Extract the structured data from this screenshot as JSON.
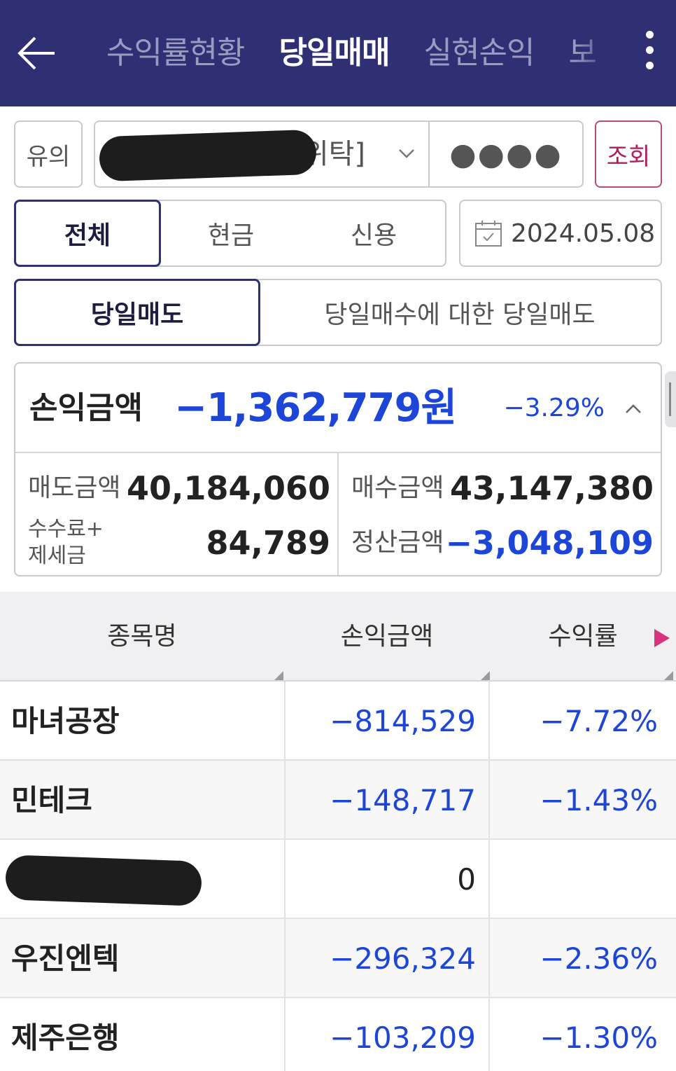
{
  "header": {
    "tabs": [
      {
        "label": "수익률현황",
        "active": false
      },
      {
        "label": "당일매매",
        "active": true
      },
      {
        "label": "실현손익",
        "active": false
      },
      {
        "label": "보",
        "active": false
      }
    ],
    "icons": {
      "back": "arrow-left-icon",
      "menu": "kebab-menu-icon"
    }
  },
  "account": {
    "notice_label": "유의",
    "account_suffix": "위탁]",
    "password_mask": "●●●●",
    "query_label": "조회"
  },
  "filters": {
    "type_tabs": [
      {
        "label": "전체",
        "active": true
      },
      {
        "label": "현금",
        "active": false
      },
      {
        "label": "신용",
        "active": false
      }
    ],
    "date": "2024.05.08",
    "mode_tabs": [
      {
        "label": "당일매도",
        "active": true
      },
      {
        "label": "당일매수에 대한 당일매도",
        "active": false
      }
    ]
  },
  "summary": {
    "pl_label": "손익금액",
    "pl_amount": "−1,362,779원",
    "pl_rate": "−3.29%",
    "sell_label": "매도금액",
    "sell_amount": "40,184,060",
    "fee_label_1": "수수료+",
    "fee_label_2": "제세금",
    "fee_amount": "84,789",
    "buy_label": "매수금액",
    "buy_amount": "43,147,380",
    "settle_label": "정산금액",
    "settle_amount": "−3,048,109"
  },
  "table": {
    "headers": [
      "종목명",
      "손익금액",
      "수익률"
    ],
    "rows": [
      {
        "name": "마녀공장",
        "pl": "−814,529",
        "rate": "−7.72%"
      },
      {
        "name": "민테크",
        "pl": "−148,717",
        "rate": "−1.43%"
      },
      {
        "name": "",
        "pl": "0",
        "rate": ""
      },
      {
        "name": "우진엔텍",
        "pl": "−296,324",
        "rate": "−2.36%"
      },
      {
        "name": "제주은행",
        "pl": "−103,209",
        "rate": "−1.30%"
      }
    ]
  },
  "colors": {
    "header_bg": "#2f2f74",
    "negative": "#1d45d8",
    "accent": "#b01e5c"
  }
}
